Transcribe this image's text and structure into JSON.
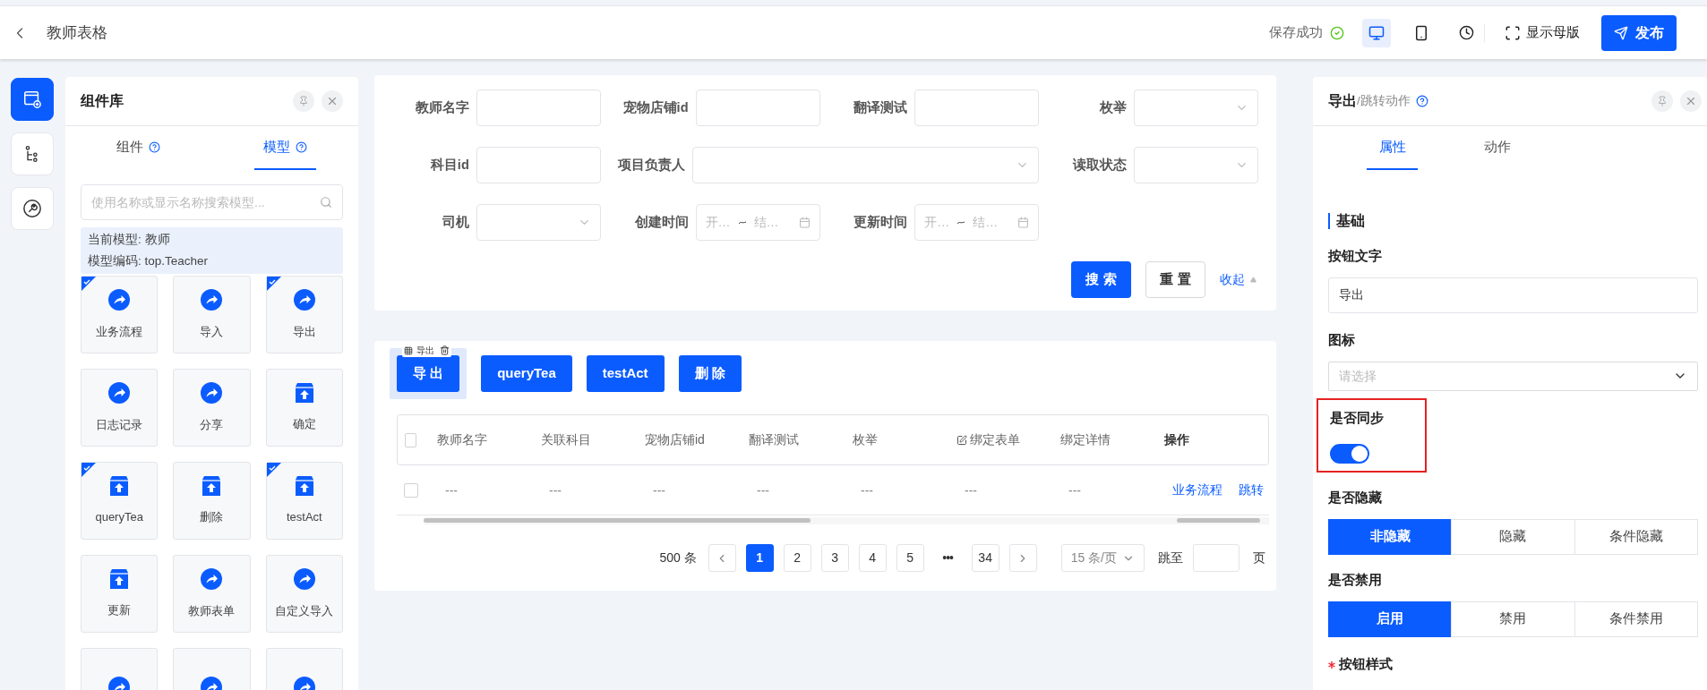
{
  "header": {
    "title": "教师表格",
    "save_status": "保存成功",
    "devices": [
      {
        "kind": "desktop",
        "selected": true
      },
      {
        "kind": "mobile",
        "selected": false
      },
      {
        "kind": "history",
        "selected": false
      }
    ],
    "master_button": "显示母版",
    "publish_button": "发布"
  },
  "rail": [
    {
      "kind": "components",
      "selected": true
    },
    {
      "kind": "tree",
      "selected": false
    },
    {
      "kind": "tools",
      "selected": false
    }
  ],
  "library": {
    "title": "组件库",
    "tabs": [
      {
        "label": "组件",
        "selected": false
      },
      {
        "label": "模型",
        "selected": true
      }
    ],
    "search": {
      "placeholder": "使用名称或显示名称搜索模型..."
    },
    "model_info": [
      "当前模型: 教师",
      "模型编码: top.Teacher"
    ],
    "tiles": [
      {
        "kind": "arrow",
        "label": "业务流程",
        "checked": true
      },
      {
        "kind": "arrow",
        "label": "导入",
        "checked": false
      },
      {
        "kind": "arrow",
        "label": "导出",
        "checked": true
      },
      {
        "kind": "arrow",
        "label": "日志记录",
        "checked": false
      },
      {
        "kind": "arrow",
        "label": "分享",
        "checked": false
      },
      {
        "kind": "box",
        "label": "确定",
        "checked": false
      },
      {
        "kind": "box",
        "label": "queryTea",
        "checked": true
      },
      {
        "kind": "box",
        "label": "删除",
        "checked": false
      },
      {
        "kind": "box",
        "label": "testAct",
        "checked": true
      },
      {
        "kind": "box",
        "label": "更新",
        "checked": false
      },
      {
        "kind": "arrow",
        "label": "教师表单",
        "checked": false
      },
      {
        "kind": "arrow",
        "label": "自定义导入",
        "checked": false
      },
      {
        "kind": "arrow",
        "checked": false
      },
      {
        "kind": "arrow",
        "checked": false
      },
      {
        "kind": "arrow",
        "checked": false
      }
    ]
  },
  "filter": {
    "fields": [
      {
        "label": "教师名字",
        "kind": "input"
      },
      {
        "label": "宠物店铺id",
        "kind": "input"
      },
      {
        "label": "翻译测试",
        "kind": "input"
      },
      {
        "label": "枚举",
        "kind": "select"
      },
      {
        "label": "科目id",
        "kind": "input"
      },
      {
        "label": "项目负责人",
        "kind": "select",
        "wide": true
      },
      {
        "label": "读取状态",
        "kind": "select"
      },
      {
        "label": "司机",
        "kind": "select"
      },
      {
        "label": "创建时间",
        "kind": "daterange",
        "start": "开…",
        "end": "结…"
      },
      {
        "label": "更新时间",
        "kind": "daterange",
        "start": "开…",
        "end": "结…"
      }
    ],
    "search_button": "搜 索",
    "reset_button": "重 置",
    "collapse_link": "收起"
  },
  "table_card": {
    "toolbar_popup": "导出",
    "select_all": false,
    "buttons": [
      {
        "label": "导 出",
        "selected": true
      },
      {
        "label": "queryTea",
        "selected": false
      },
      {
        "label": "testAct",
        "selected": false
      },
      {
        "label": "删 除",
        "selected": false
      }
    ],
    "columns": [
      {
        "label": "教师名字"
      },
      {
        "label": "关联科目"
      },
      {
        "label": "宠物店铺id"
      },
      {
        "label": "翻译测试"
      },
      {
        "label": "枚举"
      },
      {
        "label": "绑定表单",
        "editable": true
      },
      {
        "label": "绑定详情"
      },
      {
        "label": "操作",
        "bold": true
      }
    ],
    "rows": [
      {
        "checked": false,
        "cells": [
          "---",
          "---",
          "---",
          "---",
          "---",
          "---",
          "---"
        ],
        "actions": [
          "业务流程",
          "跳转"
        ]
      }
    ],
    "pagination": {
      "total": "500 条",
      "pages": [
        {
          "label": "1",
          "selected": true
        },
        {
          "label": "2",
          "selected": false
        },
        {
          "label": "3",
          "selected": false
        },
        {
          "label": "4",
          "selected": false
        },
        {
          "label": "5",
          "selected": false
        },
        {
          "label": "•••",
          "kind": "ellipsis"
        },
        {
          "label": "34",
          "selected": false
        }
      ],
      "page_size": "15 条/页",
      "jump_label": "跳至",
      "page_suffix": "页"
    }
  },
  "props_panel": {
    "title": "导出",
    "subtitle": "/跳转动作",
    "tabs": [
      {
        "label": "属性",
        "selected": true
      },
      {
        "label": "动作",
        "selected": false
      }
    ],
    "section": "基础",
    "fields": [
      {
        "kind": "input",
        "label": "按钮文字",
        "value": "导出"
      },
      {
        "kind": "select",
        "label": "图标",
        "placeholder": "请选择"
      },
      {
        "kind": "switch",
        "label": "是否同步",
        "on": true,
        "highlighted": true
      },
      {
        "kind": "segmented",
        "label": "是否隐藏",
        "options": [
          {
            "label": "非隐藏",
            "selected": true
          },
          {
            "label": "隐藏",
            "selected": false
          },
          {
            "label": "条件隐藏",
            "selected": false
          }
        ]
      },
      {
        "kind": "segmented",
        "label": "是否禁用",
        "options": [
          {
            "label": "启用",
            "selected": true
          },
          {
            "label": "禁用",
            "selected": false
          },
          {
            "label": "条件禁用",
            "selected": false
          }
        ]
      },
      {
        "kind": "heading",
        "label": "按钮样式",
        "required": true
      }
    ]
  }
}
